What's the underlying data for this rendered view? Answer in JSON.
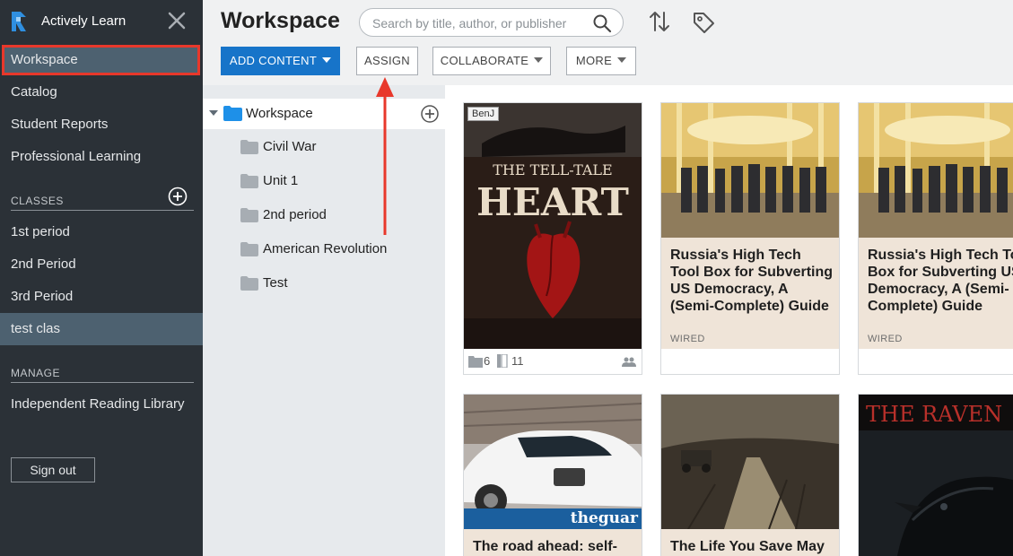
{
  "app": {
    "name": "Actively Learn"
  },
  "sidebar": {
    "nav": [
      {
        "label": "Workspace"
      },
      {
        "label": "Catalog"
      },
      {
        "label": "Student Reports"
      },
      {
        "label": "Professional Learning"
      }
    ],
    "classes_label": "CLASSES",
    "classes": [
      {
        "label": "1st period"
      },
      {
        "label": "2nd Period"
      },
      {
        "label": "3rd Period"
      },
      {
        "label": "test clas"
      }
    ],
    "manage_label": "MANAGE",
    "manage": [
      {
        "label": "Independent Reading Library"
      }
    ],
    "signout_label": "Sign out"
  },
  "header": {
    "title": "Workspace",
    "search_placeholder": "Search by title, author, or publisher",
    "buttons": {
      "add_content": "ADD CONTENT",
      "assign": "ASSIGN",
      "collaborate": "COLLABORATE",
      "more": "MORE"
    }
  },
  "tree": {
    "root": "Workspace",
    "folders": [
      {
        "label": "Civil War"
      },
      {
        "label": "Unit 1"
      },
      {
        "label": "2nd period"
      },
      {
        "label": "American Revolution"
      },
      {
        "label": "Test"
      }
    ]
  },
  "cards": [
    {
      "badge": "BenJ",
      "cover_line1": "THE TELL-TALE",
      "cover_line2": "HEART",
      "folders_count": "6",
      "pages_count": "11"
    },
    {
      "title": "Russia's High Tech Tool Box for Subverting US Democracy, A (Semi-Complete) Guide",
      "source": "WIRED"
    },
    {
      "title": "Russia's High Tech Tool Box for Subverting US Democracy, A (Semi-Complete) Guide",
      "source": "WIRED"
    },
    {
      "title": "The road ahead: self-",
      "watermark": "theguar"
    },
    {
      "title": "The Life You Save May"
    },
    {
      "cover_text": "THE RAVEN"
    }
  ],
  "colors": {
    "sidebar_bg": "#2b3137",
    "sidebar_active": "#4d6170",
    "accent_blue": "#1774c9",
    "folder_blue": "#1e90e8",
    "highlight_red": "#e8382b",
    "card_title_bg": "#efe4d8"
  }
}
